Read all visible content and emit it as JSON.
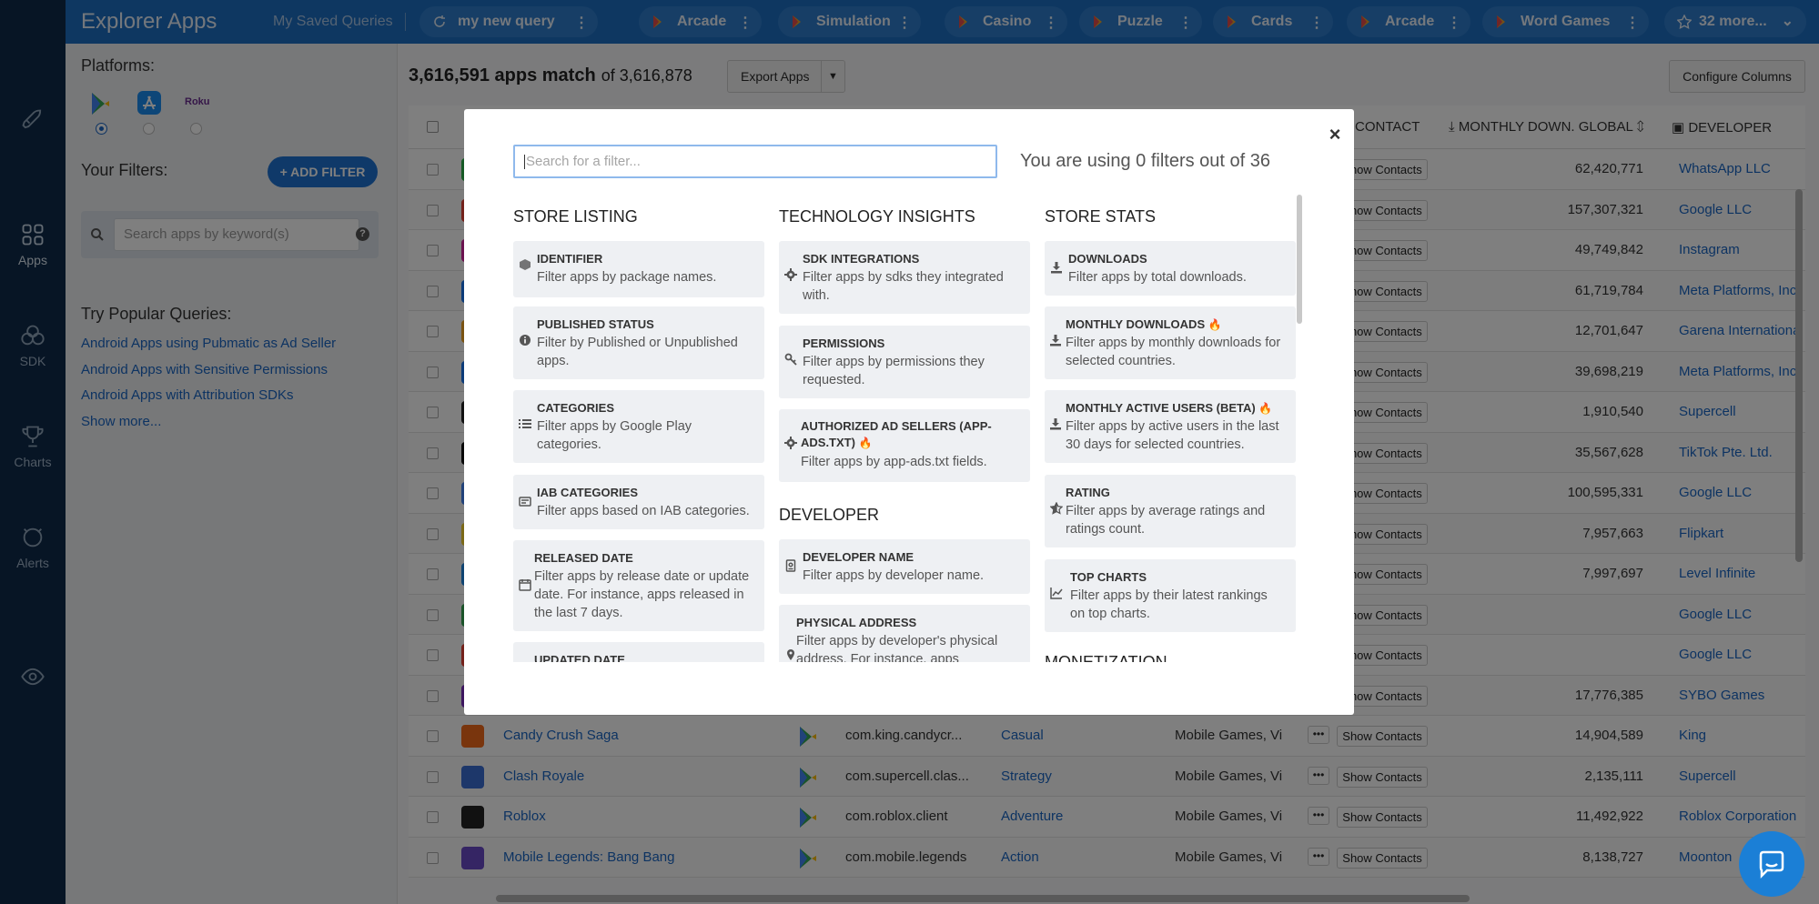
{
  "topbar": {
    "title": "Explorer Apps",
    "saved_queries": "My Saved Queries",
    "tabs": [
      {
        "label": "my new query"
      },
      {
        "label": "Arcade"
      },
      {
        "label": "Simulation"
      },
      {
        "label": "Casino"
      },
      {
        "label": "Puzzle"
      },
      {
        "label": "Cards"
      },
      {
        "label": "Arcade"
      },
      {
        "label": "Word Games"
      },
      {
        "label": "32 more..."
      }
    ]
  },
  "nav": {
    "items": [
      {
        "label": ""
      },
      {
        "label": "Apps"
      },
      {
        "label": "SDK"
      },
      {
        "label": "Charts"
      },
      {
        "label": "Alerts"
      },
      {
        "label": ""
      }
    ]
  },
  "sidebar": {
    "platforms_label": "Platforms:",
    "roku_label": "Roku",
    "your_filters": "Your Filters:",
    "add_filter": "+ ADD FILTER",
    "keyword_placeholder": "Search apps by keyword(s)",
    "popular_label": "Try Popular Queries:",
    "popular": [
      "Android Apps using Pubmatic as Ad Seller",
      "Android Apps with Sensitive Permissions",
      "Android Apps with Attribution SDKs",
      "Show more..."
    ]
  },
  "main": {
    "match_count": "3,616,591 apps match",
    "match_of": "of 3,616,878",
    "export": "Export Apps",
    "configure": "Configure Columns",
    "headers": {
      "contact": "CONTACT",
      "downloads": "MONTHLY DOWN. GLOBAL",
      "developer": "DEVELOPER"
    },
    "show_contacts": "Show Contacts",
    "rows": [
      {
        "name": "",
        "pkg": "",
        "cat": "",
        "tags": "",
        "dl": "62,420,771",
        "dev": "WhatsApp LLC"
      },
      {
        "name": "",
        "pkg": "",
        "cat": "",
        "tags": "",
        "dl": "157,307,321",
        "dev": "Google LLC"
      },
      {
        "name": "",
        "pkg": "",
        "cat": "",
        "tags": "",
        "dl": "49,749,842",
        "dev": "Instagram"
      },
      {
        "name": "",
        "pkg": "",
        "cat": "",
        "tags": "",
        "dl": "61,719,784",
        "dev": "Meta Platforms, Inc"
      },
      {
        "name": "",
        "pkg": "",
        "cat": "",
        "tags": "",
        "dl": "12,701,647",
        "dev": "Garena International"
      },
      {
        "name": "",
        "pkg": "",
        "cat": "",
        "tags": "",
        "dl": "39,698,219",
        "dev": "Meta Platforms, Inc"
      },
      {
        "name": "",
        "pkg": "",
        "cat": "",
        "tags": "",
        "dl": "1,910,540",
        "dev": "Supercell"
      },
      {
        "name": "",
        "pkg": "",
        "cat": "",
        "tags": "",
        "dl": "35,567,628",
        "dev": "TikTok Pte. Ltd."
      },
      {
        "name": "",
        "pkg": "",
        "cat": "",
        "tags": "",
        "dl": "100,595,331",
        "dev": "Google LLC"
      },
      {
        "name": "",
        "pkg": "",
        "cat": "",
        "tags": "",
        "dl": "7,957,663",
        "dev": "Flipkart"
      },
      {
        "name": "",
        "pkg": "",
        "cat": "",
        "tags": "",
        "dl": "7,997,697",
        "dev": "Level Infinite"
      },
      {
        "name": "",
        "pkg": "",
        "cat": "",
        "tags": "",
        "dl": "",
        "dev": "Google LLC"
      },
      {
        "name": "",
        "pkg": "",
        "cat": "",
        "tags": "",
        "dl": "",
        "dev": "Google LLC"
      },
      {
        "name": "",
        "pkg": "",
        "cat": "",
        "tags": "",
        "dl": "17,776,385",
        "dev": "SYBO Games"
      },
      {
        "name": "Candy Crush Saga",
        "pkg": "com.king.candycr...",
        "cat": "Casual",
        "tags": "Mobile Games, Vi",
        "dl": "14,904,589",
        "dev": "King"
      },
      {
        "name": "Clash Royale",
        "pkg": "com.supercell.clas...",
        "cat": "Strategy",
        "tags": "Mobile Games, Vi",
        "dl": "2,135,111",
        "dev": "Supercell"
      },
      {
        "name": "Roblox",
        "pkg": "com.roblox.client",
        "cat": "Adventure",
        "tags": "Mobile Games, Vi",
        "dl": "11,492,922",
        "dev": "Roblox Corporation"
      },
      {
        "name": "Mobile Legends: Bang Bang",
        "pkg": "com.mobile.legends",
        "cat": "Action",
        "tags": "Mobile Games, Vi",
        "dl": "8,138,727",
        "dev": "Moonton"
      }
    ]
  },
  "modal": {
    "search_placeholder": "Search for a filter...",
    "usage": "You are using 0 filters out of 36",
    "columns": [
      {
        "title": "STORE LISTING",
        "cards": [
          {
            "title": "IDENTIFIER",
            "desc": "Filter apps by package names."
          },
          {
            "title": "PUBLISHED STATUS",
            "desc": "Filter by Published or Unpublished apps."
          },
          {
            "title": "CATEGORIES",
            "desc": "Filter apps by Google Play categories."
          },
          {
            "title": "IAB CATEGORIES",
            "desc": "Filter apps based on IAB categories."
          },
          {
            "title": "RELEASED DATE",
            "desc": "Filter apps by release date or update date. For instance, apps released in the last 7 days."
          },
          {
            "title": "UPDATED DATE",
            "desc": ""
          }
        ]
      },
      {
        "title": "TECHNOLOGY INSIGHTS",
        "cards": [
          {
            "title": "SDK INTEGRATIONS",
            "desc": "Filter apps by sdks they integrated with."
          },
          {
            "title": "PERMISSIONS",
            "desc": "Filter apps by permissions they requested."
          },
          {
            "title": "AUTHORIZED AD SELLERS (APP-ADS.TXT)",
            "desc": "Filter apps by app-ads.txt fields."
          }
        ],
        "title2": "DEVELOPER",
        "cards2": [
          {
            "title": "DEVELOPER NAME",
            "desc": "Filter apps by developer name."
          },
          {
            "title": "PHYSICAL ADDRESS",
            "desc": "Filter apps by developer's physical address. For instance, apps"
          }
        ]
      },
      {
        "title": "STORE STATS",
        "cards": [
          {
            "title": "DOWNLOADS",
            "desc": "Filter apps by total downloads."
          },
          {
            "title": "MONTHLY DOWNLOADS",
            "desc": "Filter apps by monthly downloads for selected countries."
          },
          {
            "title": "MONTHLY ACTIVE USERS (BETA)",
            "desc": "Filter apps by active users in the last 30 days for selected countries."
          },
          {
            "title": "RATING",
            "desc": "Filter apps by average ratings and ratings count."
          },
          {
            "title": "TOP CHARTS",
            "desc": "Filter apps by their latest rankings on top charts."
          }
        ],
        "title2": "MONETIZATION"
      }
    ]
  }
}
